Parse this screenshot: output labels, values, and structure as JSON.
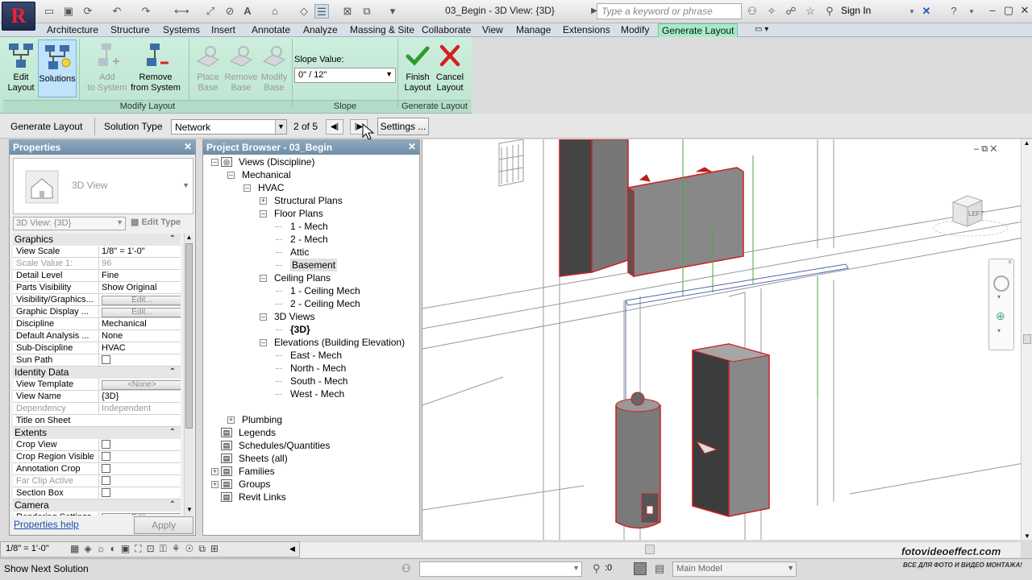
{
  "titlebar": {
    "app_letter": "R",
    "document_title": "03_Begin - 3D View: {3D}",
    "search_placeholder": "Type a keyword or phrase",
    "sign_in": "Sign In"
  },
  "tabs": [
    "Architecture",
    "Structure",
    "Systems",
    "Insert",
    "Annotate",
    "Analyze",
    "Massing & Site",
    "Collaborate",
    "View",
    "Manage",
    "Extensions",
    "Modify",
    "Generate Layout"
  ],
  "active_tab": "Generate Layout",
  "ribbon": {
    "panels": {
      "modify_layout": "Modify Layout",
      "slope": "Slope",
      "generate_layout": "Generate Layout"
    },
    "buttons": {
      "edit_layout": [
        "Edit",
        "Layout"
      ],
      "solutions": [
        "Solutions"
      ],
      "add_to_system": [
        "Add",
        "to System"
      ],
      "remove_from_system": [
        "Remove",
        "from System"
      ],
      "place_base": [
        "Place",
        "Base"
      ],
      "remove_base": [
        "Remove",
        "Base"
      ],
      "modify_base": [
        "Modify",
        "Base"
      ],
      "finish_layout": [
        "Finish",
        "Layout"
      ],
      "cancel_layout": [
        "Cancel",
        "Layout"
      ]
    },
    "slope_label": "Slope Value:",
    "slope_value": "0\" / 12\""
  },
  "options_bar": {
    "context": "Generate Layout",
    "solution_type_label": "Solution Type",
    "solution_type_value": "Network",
    "counter": "2 of 5",
    "settings": "Settings ..."
  },
  "properties": {
    "title": "Properties",
    "type_name": "3D View",
    "instance_selector": "3D View: {3D}",
    "edit_type": "Edit Type",
    "help_link": "Properties help",
    "apply": "Apply",
    "groups": [
      {
        "name": "Graphics",
        "rows": [
          {
            "k": "View Scale",
            "v": "1/8\" = 1'-0\""
          },
          {
            "k": "Scale Value    1:",
            "v": "96",
            "dis": true
          },
          {
            "k": "Detail Level",
            "v": "Fine"
          },
          {
            "k": "Parts Visibility",
            "v": "Show Original"
          },
          {
            "k": "Visibility/Graphics...",
            "v": "Edit...",
            "btn": true
          },
          {
            "k": "Graphic Display ...",
            "v": "Edit...",
            "btn": true
          },
          {
            "k": "Discipline",
            "v": "Mechanical"
          },
          {
            "k": "Default Analysis ...",
            "v": "None"
          },
          {
            "k": "Sub-Discipline",
            "v": "HVAC"
          },
          {
            "k": "Sun Path",
            "v": "",
            "cb": true
          }
        ]
      },
      {
        "name": "Identity Data",
        "rows": [
          {
            "k": "View Template",
            "v": "<None>",
            "btn": true
          },
          {
            "k": "View Name",
            "v": "{3D}"
          },
          {
            "k": "Dependency",
            "v": "Independent",
            "dis": true
          },
          {
            "k": "Title on Sheet",
            "v": ""
          }
        ]
      },
      {
        "name": "Extents",
        "rows": [
          {
            "k": "Crop View",
            "v": "",
            "cb": true
          },
          {
            "k": "Crop Region Visible",
            "v": "",
            "cb": true
          },
          {
            "k": "Annotation Crop",
            "v": "",
            "cb": true
          },
          {
            "k": "Far Clip Active",
            "v": "",
            "cb": true,
            "dis": true
          },
          {
            "k": "Section Box",
            "v": "",
            "cb": true
          }
        ]
      },
      {
        "name": "Camera",
        "rows": [
          {
            "k": "Rendering Settings",
            "v": "Edit...",
            "btn": true
          }
        ]
      }
    ]
  },
  "browser": {
    "title": "Project Browser - 03_Begin",
    "nodes": [
      {
        "label": "Views (Discipline)",
        "lvl": 0,
        "tog": "-"
      },
      {
        "label": "Mechanical",
        "lvl": 1,
        "tog": "-"
      },
      {
        "label": "HVAC",
        "lvl": 2,
        "tog": "-"
      },
      {
        "label": "Structural Plans",
        "lvl": 3,
        "tog": "+"
      },
      {
        "label": "Floor Plans",
        "lvl": 3,
        "tog": "-"
      },
      {
        "label": "1 - Mech",
        "lvl": 4
      },
      {
        "label": "2 - Mech",
        "lvl": 4
      },
      {
        "label": "Attic",
        "lvl": 4
      },
      {
        "label": "Basement",
        "lvl": 4,
        "sel": true
      },
      {
        "label": "Ceiling Plans",
        "lvl": 3,
        "tog": "-"
      },
      {
        "label": "1 - Ceiling Mech",
        "lvl": 4
      },
      {
        "label": "2 - Ceiling Mech",
        "lvl": 4
      },
      {
        "label": "3D Views",
        "lvl": 3,
        "tog": "-"
      },
      {
        "label": "{3D}",
        "lvl": 4,
        "bold": true
      },
      {
        "label": "Elevations (Building Elevation)",
        "lvl": 3,
        "tog": "-"
      },
      {
        "label": "East - Mech",
        "lvl": 4
      },
      {
        "label": "North - Mech",
        "lvl": 4
      },
      {
        "label": "South - Mech",
        "lvl": 4
      },
      {
        "label": "West - Mech",
        "lvl": 4
      },
      {
        "label": "",
        "lvl": -1
      },
      {
        "label": "Plumbing",
        "lvl": 1,
        "tog": "+"
      },
      {
        "label": "Legends",
        "lvl": 0,
        "icon": true
      },
      {
        "label": "Schedules/Quantities",
        "lvl": 0,
        "icon": true
      },
      {
        "label": "Sheets (all)",
        "lvl": 0,
        "icon": true
      },
      {
        "label": "Families",
        "lvl": 0,
        "tog": "+",
        "icon": true
      },
      {
        "label": "Groups",
        "lvl": 0,
        "tog": "+",
        "icon": true
      },
      {
        "label": "Revit Links",
        "lvl": 0,
        "icon": true
      }
    ]
  },
  "viewcube_label": "LEFT",
  "viewbar": {
    "scale": "1/8\" = 1'-0\""
  },
  "status": {
    "message": "Show Next Solution",
    "selection_count": ":0",
    "model": "Main Model",
    "watermark1": "fotovideoeffect.com",
    "watermark2": "ВСЕ ДЛЯ ФОТО И ВИДЕО МОНТАЖА!"
  }
}
